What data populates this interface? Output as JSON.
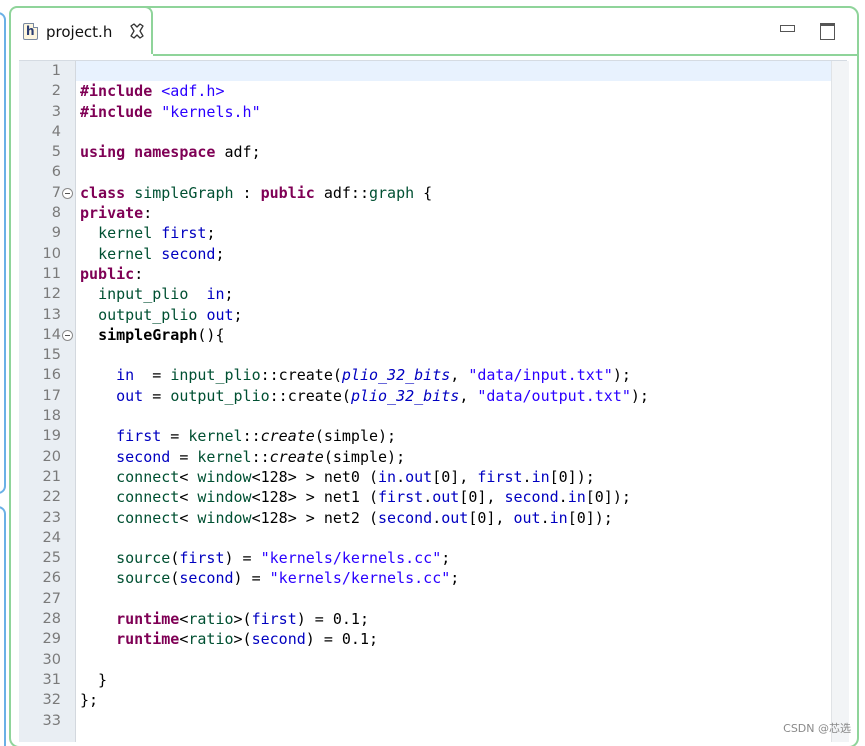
{
  "tab": {
    "title": "project.h",
    "icon_letter": "h",
    "file_icon": "header-file-icon",
    "close_icon": "close-tab-icon"
  },
  "window_controls": {
    "minimize_icon": "minimize-icon",
    "maximize_icon": "maximize-icon"
  },
  "watermark": "CSDN @芯选",
  "code_lines": [
    {
      "n": "1",
      "fold": false,
      "html": ""
    },
    {
      "n": "2",
      "fold": false,
      "html": "<span class=\"kw\">#include</span> <span class=\"str\">&lt;adf.h&gt;</span>"
    },
    {
      "n": "3",
      "fold": false,
      "html": "<span class=\"kw\">#include</span> <span class=\"str\">\"kernels.h\"</span>"
    },
    {
      "n": "4",
      "fold": false,
      "html": ""
    },
    {
      "n": "5",
      "fold": false,
      "html": "<span class=\"kw\">using namespace</span> adf;"
    },
    {
      "n": "6",
      "fold": false,
      "html": ""
    },
    {
      "n": "7",
      "fold": true,
      "html": "<span class=\"kw\">class</span> <span class=\"ty\">simpleGraph</span> : <span class=\"kw\">public</span> adf::<span class=\"ty\">graph</span> {"
    },
    {
      "n": "8",
      "fold": false,
      "html": "<span class=\"kw\">private</span>:"
    },
    {
      "n": "9",
      "fold": false,
      "html": "  <span class=\"ty\">kernel</span> <span class=\"fld\">first</span>;"
    },
    {
      "n": "10",
      "fold": false,
      "html": "  <span class=\"ty\">kernel</span> <span class=\"fld\">second</span>;"
    },
    {
      "n": "11",
      "fold": false,
      "html": "<span class=\"kw\">public</span>:"
    },
    {
      "n": "12",
      "fold": false,
      "html": "  <span class=\"ty\">input_plio</span>  <span class=\"fld\">in</span>;"
    },
    {
      "n": "13",
      "fold": false,
      "html": "  <span class=\"ty\">output_plio</span> <span class=\"fld\">out</span>;"
    },
    {
      "n": "14",
      "fold": true,
      "html": "  <span class=\"b\">simpleGraph</span>(){"
    },
    {
      "n": "15",
      "fold": false,
      "html": ""
    },
    {
      "n": "16",
      "fold": false,
      "html": "    <span class=\"fld\">in</span>  = <span class=\"ty\">input_plio</span>::create(<span class=\"itf\">plio_32_bits</span>, <span class=\"str\">\"data/input.txt\"</span>);"
    },
    {
      "n": "17",
      "fold": false,
      "html": "    <span class=\"fld\">out</span> = <span class=\"ty\">output_plio</span>::create(<span class=\"itf\">plio_32_bits</span>, <span class=\"str\">\"data/output.txt\"</span>);"
    },
    {
      "n": "18",
      "fold": false,
      "html": ""
    },
    {
      "n": "19",
      "fold": false,
      "html": "    <span class=\"fld\">first</span> = <span class=\"ty\">kernel</span>::<span class=\"it\">create</span>(simple);"
    },
    {
      "n": "20",
      "fold": false,
      "html": "    <span class=\"fld\">second</span> = <span class=\"ty\">kernel</span>::<span class=\"it\">create</span>(simple);"
    },
    {
      "n": "21",
      "fold": false,
      "html": "    <span class=\"ty\">connect</span>&lt; <span class=\"ty\">window</span>&lt;128&gt; &gt; net0 (<span class=\"fld\">in</span>.<span class=\"fld\">out</span>[0], <span class=\"fld\">first</span>.<span class=\"fld\">in</span>[0]);"
    },
    {
      "n": "22",
      "fold": false,
      "html": "    <span class=\"ty\">connect</span>&lt; <span class=\"ty\">window</span>&lt;128&gt; &gt; net1 (<span class=\"fld\">first</span>.<span class=\"fld\">out</span>[0], <span class=\"fld\">second</span>.<span class=\"fld\">in</span>[0]);"
    },
    {
      "n": "23",
      "fold": false,
      "html": "    <span class=\"ty\">connect</span>&lt; <span class=\"ty\">window</span>&lt;128&gt; &gt; net2 (<span class=\"fld\">second</span>.<span class=\"fld\">out</span>[0], <span class=\"fld\">out</span>.<span class=\"fld\">in</span>[0]);"
    },
    {
      "n": "24",
      "fold": false,
      "html": ""
    },
    {
      "n": "25",
      "fold": false,
      "html": "    <span class=\"ty\">source</span>(<span class=\"fld\">first</span>) = <span class=\"str\">\"kernels/kernels.cc\"</span>;"
    },
    {
      "n": "26",
      "fold": false,
      "html": "    <span class=\"ty\">source</span>(<span class=\"fld\">second</span>) = <span class=\"str\">\"kernels/kernels.cc\"</span>;"
    },
    {
      "n": "27",
      "fold": false,
      "html": ""
    },
    {
      "n": "28",
      "fold": false,
      "html": "    <span class=\"kw\">runtime</span>&lt;<span class=\"ty\">ratio</span>&gt;(<span class=\"fld\">first</span>) = 0.1;"
    },
    {
      "n": "29",
      "fold": false,
      "html": "    <span class=\"kw\">runtime</span>&lt;<span class=\"ty\">ratio</span>&gt;(<span class=\"fld\">second</span>) = 0.1;"
    },
    {
      "n": "30",
      "fold": false,
      "html": ""
    },
    {
      "n": "31",
      "fold": false,
      "html": "  }"
    },
    {
      "n": "32",
      "fold": false,
      "html": "};"
    },
    {
      "n": "33",
      "fold": false,
      "html": ""
    }
  ]
}
